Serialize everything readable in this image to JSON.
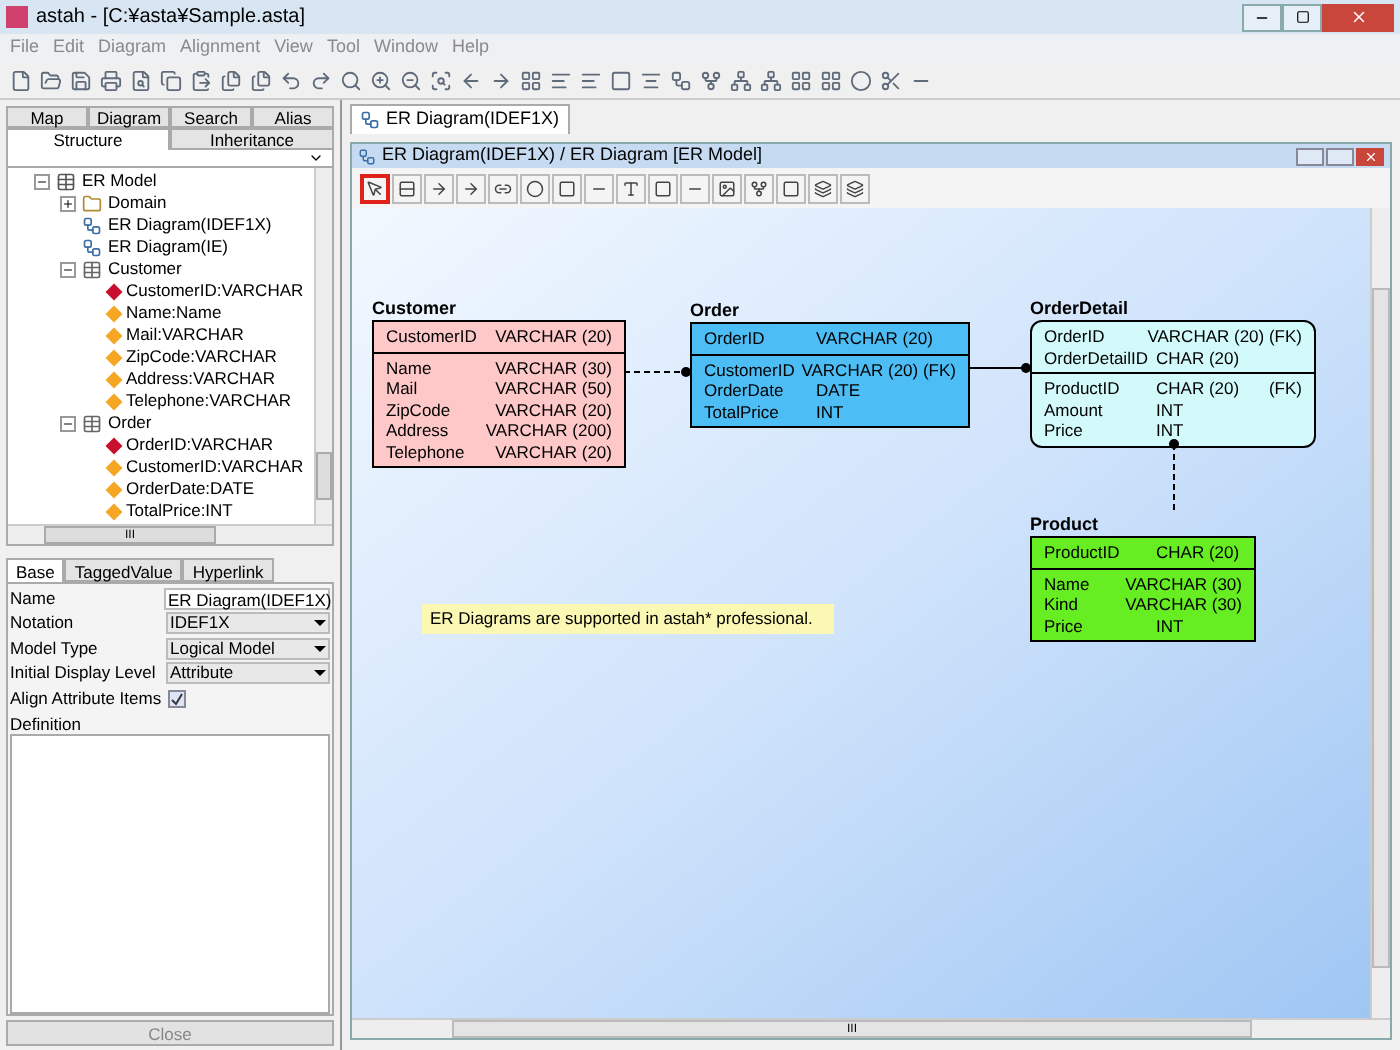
{
  "window": {
    "title": "astah - [C:¥asta¥Sample.asta]"
  },
  "menu": [
    "File",
    "Edit",
    "Diagram",
    "Alignment",
    "View",
    "Tool",
    "Window",
    "Help"
  ],
  "explorer": {
    "tab_rows": [
      [
        {
          "label": "Map",
          "selected": false
        },
        {
          "label": "Diagram",
          "selected": false
        },
        {
          "label": "Search",
          "selected": false
        },
        {
          "label": "Alias",
          "selected": false
        }
      ],
      [
        {
          "label": "Structure",
          "selected": true
        },
        {
          "label": "Inheritance",
          "selected": false
        }
      ]
    ],
    "tree": [
      {
        "label": "ER Model",
        "kind": "model",
        "expanded": true,
        "children": [
          {
            "label": "Domain",
            "kind": "folder",
            "expanded": false
          },
          {
            "label": "ER Diagram(IDEF1X)",
            "kind": "diagram"
          },
          {
            "label": "ER Diagram(IE)",
            "kind": "diagram"
          },
          {
            "label": "Customer",
            "kind": "table",
            "expanded": true,
            "children": [
              {
                "label": "CustomerID:VARCHAR",
                "kind": "pk"
              },
              {
                "label": "Name:Name",
                "kind": "attr"
              },
              {
                "label": "Mail:VARCHAR",
                "kind": "attr"
              },
              {
                "label": "ZipCode:VARCHAR",
                "kind": "attr"
              },
              {
                "label": "Address:VARCHAR",
                "kind": "attr"
              },
              {
                "label": "Telephone:VARCHAR",
                "kind": "attr"
              }
            ]
          },
          {
            "label": "Order",
            "kind": "table",
            "expanded": true,
            "children": [
              {
                "label": "OrderID:VARCHAR",
                "kind": "pk"
              },
              {
                "label": "CustomerID:VARCHAR",
                "kind": "attr"
              },
              {
                "label": "OrderDate:DATE",
                "kind": "attr"
              },
              {
                "label": "TotalPrice:INT",
                "kind": "attr"
              }
            ]
          }
        ]
      }
    ],
    "horizontal_scroll_marker": "III"
  },
  "properties": {
    "tabs": [
      {
        "label": "Base",
        "selected": true
      },
      {
        "label": "TaggedValue",
        "selected": false
      },
      {
        "label": "Hyperlink",
        "selected": false
      }
    ],
    "rows": [
      {
        "label": "Name",
        "kind": "text",
        "value": "ER Diagram(IDEF1X)"
      },
      {
        "label": "Notation",
        "kind": "select",
        "value": "IDEF1X"
      },
      {
        "label": "Model Type",
        "kind": "select",
        "value": "Logical Model"
      },
      {
        "label": "Initial Display Level",
        "kind": "select",
        "value": "Attribute"
      },
      {
        "label": "Align Attribute Items",
        "kind": "checkbox",
        "checked": true
      }
    ],
    "definition_label": "Definition",
    "close_button": "Close"
  },
  "editor": {
    "tab": "ER Diagram(IDEF1X)",
    "frame_title": "ER Diagram(IDEF1X) / ER Diagram [ER Model]",
    "tools": [
      {
        "selected": true
      },
      {
        "selected": false
      },
      {
        "selected": false
      },
      {
        "selected": false
      },
      {
        "selected": false
      },
      {
        "selected": false
      },
      {
        "selected": false
      },
      {
        "selected": false
      },
      {
        "selected": false
      },
      {
        "selected": false
      },
      {
        "selected": false
      },
      {
        "selected": false
      },
      {
        "selected": false
      },
      {
        "selected": false
      },
      {
        "selected": false
      },
      {
        "selected": false
      }
    ],
    "entities": [
      {
        "name": "Customer",
        "kind": "independent",
        "color": "#ffc8c8",
        "keys": [
          {
            "name": "CustomerID",
            "type": "VARCHAR (20)"
          }
        ],
        "attributes": [
          {
            "name": "Name",
            "type": "VARCHAR (30)"
          },
          {
            "name": "Mail",
            "type": "VARCHAR (50)"
          },
          {
            "name": "ZipCode",
            "type": "VARCHAR (20)"
          },
          {
            "name": "Address",
            "type": "VARCHAR (200)"
          },
          {
            "name": "Telephone",
            "type": "VARCHAR (20)"
          }
        ]
      },
      {
        "name": "Order",
        "kind": "independent",
        "color": "#4dbdf5",
        "keys": [
          {
            "name": "OrderID",
            "type": "VARCHAR (20)"
          }
        ],
        "attributes": [
          {
            "name": "CustomerID",
            "type": "VARCHAR (20) (FK)"
          },
          {
            "name": "OrderDate",
            "type": "DATE"
          },
          {
            "name": "TotalPrice",
            "type": "INT"
          }
        ]
      },
      {
        "name": "OrderDetail",
        "kind": "dependent",
        "color": "#d2fafa",
        "keys": [
          {
            "name": "OrderID",
            "type": "VARCHAR (20) (FK)"
          },
          {
            "name": "OrderDetailID",
            "type": "CHAR (20)"
          }
        ],
        "attributes": [
          {
            "name": "ProductID",
            "type": "CHAR (20)",
            "note": "(FK)"
          },
          {
            "name": "Amount",
            "type": "INT"
          },
          {
            "name": "Price",
            "type": "INT"
          }
        ]
      },
      {
        "name": "Product",
        "kind": "independent",
        "color": "#66ee22",
        "keys": [
          {
            "name": "ProductID",
            "type": "CHAR (20)"
          }
        ],
        "attributes": [
          {
            "name": "Name",
            "type": "VARCHAR (30)"
          },
          {
            "name": "Kind",
            "type": "VARCHAR (30)"
          },
          {
            "name": "Price",
            "type": "INT"
          }
        ]
      }
    ],
    "relationships": [
      {
        "kind": "non-identifying"
      },
      {
        "kind": "identifying"
      },
      {
        "kind": "non-identifying"
      }
    ],
    "note": "ER Diagrams are supported in astah* professional.",
    "scroll_marker": "III"
  }
}
